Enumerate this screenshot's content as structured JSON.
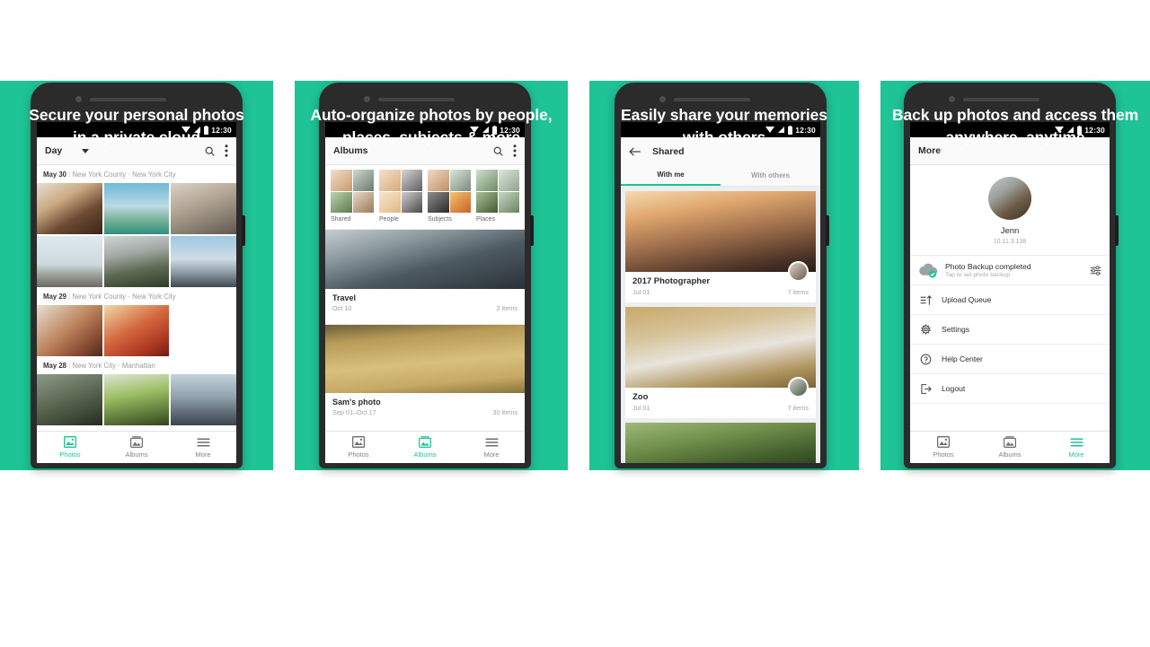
{
  "theme": {
    "accent": "#1ec396",
    "phone_body": "#2b2b2b",
    "status_bar": "#000000"
  },
  "panels": [
    {
      "headline": "Secure your personal photos in a private cloud",
      "headline_lines": [
        "Secure your personal photos",
        "in a private cloud"
      ],
      "status": {
        "time": "12:30",
        "icons": [
          "wifi-icon",
          "signal-icon",
          "battery-icon"
        ]
      },
      "appbar": {
        "title": "Day",
        "has_caret": true,
        "icons": [
          "search-icon",
          "overflow-menu-icon"
        ]
      },
      "day_groups": [
        {
          "date": "May 30",
          "place": "New York County · New York City"
        },
        {
          "date": "May 29",
          "place": "New York County · New York City"
        },
        {
          "date": "May 28",
          "place": "New York City · Manhattan"
        }
      ],
      "bottom_nav": [
        {
          "label": "Photos",
          "icon": "photos-icon",
          "active": true
        },
        {
          "label": "Albums",
          "icon": "albums-icon",
          "active": false
        },
        {
          "label": "More",
          "icon": "more-icon",
          "active": false
        }
      ]
    },
    {
      "headline": "Auto-organize photos by people, places, subjects & more",
      "headline_lines": [
        "Auto-organize photos by people,",
        "places, subjects & more"
      ],
      "status": {
        "time": "12:30",
        "icons": [
          "wifi-icon",
          "signal-icon",
          "battery-icon"
        ]
      },
      "appbar": {
        "title": "Albums",
        "has_caret": false,
        "icons": [
          "search-icon",
          "overflow-menu-icon"
        ]
      },
      "categories": [
        {
          "label": "Shared"
        },
        {
          "label": "People"
        },
        {
          "label": "Subjects"
        },
        {
          "label": "Places"
        }
      ],
      "albums": [
        {
          "title": "Travel",
          "date": "Oct 10",
          "count": "2 items"
        },
        {
          "title": "Sam's photo",
          "date": "Sep 01–Oct 17",
          "count": "30 items"
        }
      ],
      "bottom_nav": [
        {
          "label": "Photos",
          "icon": "photos-icon",
          "active": false
        },
        {
          "label": "Albums",
          "icon": "albums-icon",
          "active": true
        },
        {
          "label": "More",
          "icon": "more-icon",
          "active": false
        }
      ]
    },
    {
      "headline": "Easily share your memories with others",
      "headline_lines": [
        "Easily share your memories",
        "with others"
      ],
      "status": {
        "time": "12:30",
        "icons": [
          "wifi-icon",
          "signal-icon",
          "battery-icon"
        ]
      },
      "appbar": {
        "title": "Shared",
        "has_caret": false,
        "icons": [
          "back-arrow-icon"
        ]
      },
      "tabs": [
        {
          "label": "With me",
          "active": true
        },
        {
          "label": "With others",
          "active": false
        }
      ],
      "shared_items": [
        {
          "title": "2017 Photographer",
          "date": "Jul 01",
          "count": "7 items"
        },
        {
          "title": "Zoo",
          "date": "Jul 01",
          "count": "7 items"
        },
        {
          "title": "",
          "date": "",
          "count": ""
        }
      ]
    },
    {
      "headline": "Back up photos and access them anywhere, anytime",
      "headline_lines": [
        "Back up photos and access them",
        "anywhere, anytime"
      ],
      "status": {
        "time": "12:30",
        "icons": [
          "wifi-icon",
          "signal-icon",
          "battery-icon"
        ]
      },
      "appbar": {
        "title": "More",
        "has_caret": false,
        "icons": []
      },
      "profile": {
        "name": "Jenn",
        "ip": "10.11.3.138",
        "avatar": "user-avatar"
      },
      "backup": {
        "title": "Photo Backup completed",
        "subtitle": "Tap to set photo backup",
        "status_icon": "cloud-check-icon",
        "action_icon": "sliders-icon"
      },
      "menu": [
        {
          "label": "Upload Queue",
          "icon": "upload-queue-icon"
        },
        {
          "label": "Settings",
          "icon": "gear-icon"
        },
        {
          "label": "Help Center",
          "icon": "help-circle-icon"
        },
        {
          "label": "Logout",
          "icon": "logout-icon"
        }
      ],
      "bottom_nav": [
        {
          "label": "Photos",
          "icon": "photos-icon",
          "active": false
        },
        {
          "label": "Albums",
          "icon": "albums-icon",
          "active": false
        },
        {
          "label": "More",
          "icon": "more-icon",
          "active": true
        }
      ]
    }
  ]
}
